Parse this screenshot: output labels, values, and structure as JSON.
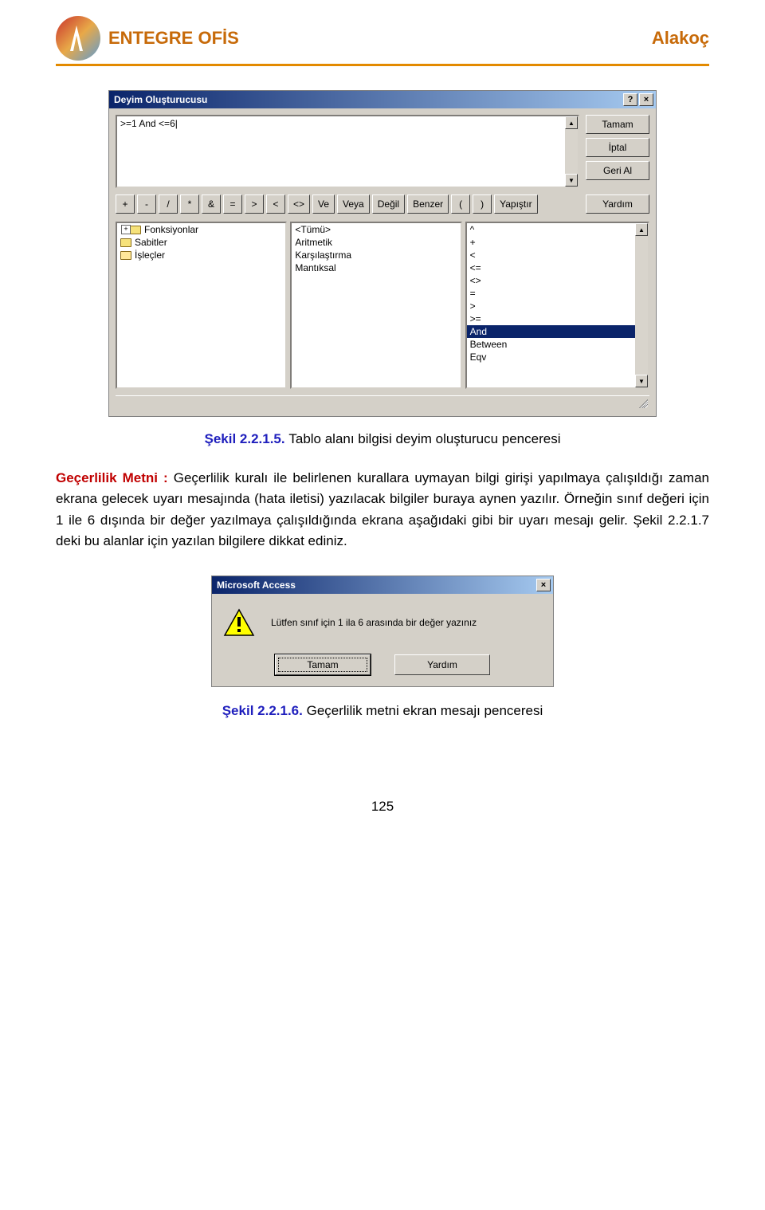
{
  "header": {
    "title_left": "ENTEGRE OFİS",
    "title_right": "Alakoç"
  },
  "expr_dialog": {
    "title": "Deyim Oluşturucusu",
    "help_btn": "?",
    "close_btn": "×",
    "expression_value": ">=1 And <=6|",
    "side_buttons": {
      "ok": "Tamam",
      "cancel": "İptal",
      "undo": "Geri Al",
      "help": "Yardım"
    },
    "op_buttons": [
      "+",
      "-",
      "/",
      "*",
      "&",
      "=",
      ">",
      "<",
      "<>",
      "Ve",
      "Veya",
      "Değil",
      "Benzer",
      "(",
      ")",
      "Yapıştır"
    ],
    "col1": [
      {
        "label": "Fonksiyonlar",
        "icon": "plus"
      },
      {
        "label": "Sabitler",
        "icon": "folder"
      },
      {
        "label": "İşleçler",
        "icon": "open"
      }
    ],
    "col2": [
      "<Tümü>",
      "Aritmetik",
      "Karşılaştırma",
      "Mantıksal"
    ],
    "col3": [
      "^",
      "+",
      "<",
      "<=",
      "<>",
      "=",
      ">",
      ">=",
      "And",
      "Between",
      "Eqv"
    ],
    "col3_selected_index": 8
  },
  "fig1": {
    "number": "Şekil 2.2.1.5.",
    "text": "Tablo alanı bilgisi deyim oluşturucu penceresi"
  },
  "para": {
    "label": "Geçerlilik Metni :",
    "rest1": " Geçerlilik kuralı ile belirlenen kurallara uymayan bilgi girişi yapılmaya çalışıldığı zaman ekrana gelecek uyarı mesajında (hata iletisi) yazılacak bilgiler buraya aynen yazılır. Örneğin sınıf değeri için 1 ile 6 dışında bir değer yazılmaya çalışıldığında ekrana aşağıdaki gibi bir uyarı mesajı gelir. Şekil 2.2.1.7 deki bu alanlar için yazılan bilgilere dikkat ediniz."
  },
  "msgbox": {
    "title": "Microsoft Access",
    "close_btn": "×",
    "message": "Lütfen sınıf için 1 ila 6 arasında bir değer yazınız",
    "ok": "Tamam",
    "help": "Yardım"
  },
  "fig2": {
    "number": "Şekil 2.2.1.6.",
    "text": "Geçerlilik metni ekran mesajı penceresi"
  },
  "page_number": "125"
}
